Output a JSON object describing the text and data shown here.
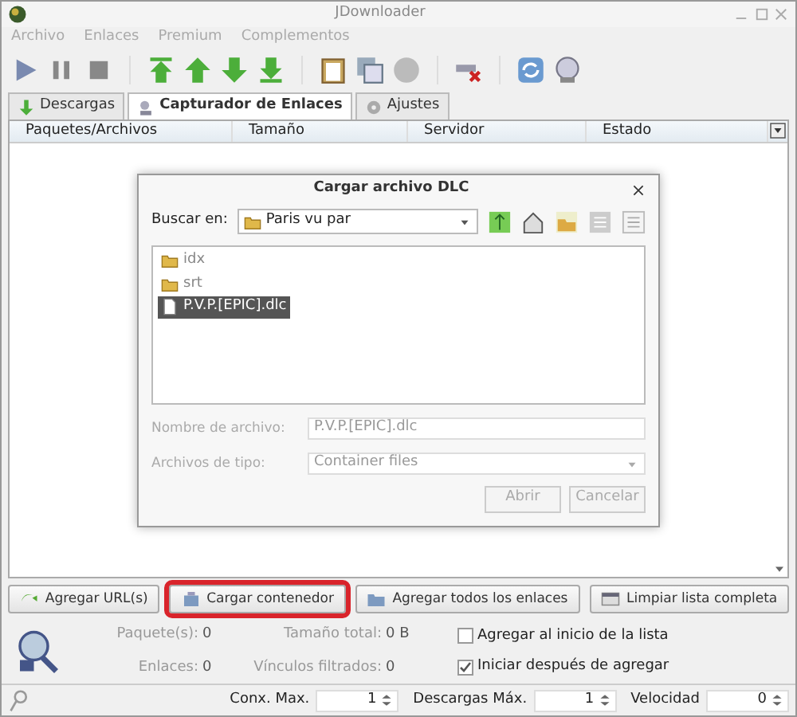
{
  "window": {
    "title": "JDownloader"
  },
  "menu": [
    "Archivo",
    "Enlaces",
    "Premium",
    "Complementos"
  ],
  "tabs": [
    {
      "label": "Descargas",
      "selected": false
    },
    {
      "label": "Capturador de Enlaces",
      "selected": true
    },
    {
      "label": "Ajustes",
      "selected": false
    }
  ],
  "table": {
    "columns": [
      "Paquetes/Archivos",
      "Tamaño",
      "Servidor",
      "Estado"
    ]
  },
  "dialog": {
    "title": "Cargar archivo DLC",
    "look_in_label": "Buscar en:",
    "look_in_value": "Paris vu par",
    "files": [
      {
        "name": "idx",
        "kind": "folder",
        "selected": false
      },
      {
        "name": "srt",
        "kind": "folder",
        "selected": false
      },
      {
        "name": "P.V.P.[EPIC].dlc",
        "kind": "file",
        "selected": true
      }
    ],
    "filename_label": "Nombre de archivo:",
    "filename_value": "P.V.P.[EPIC].dlc",
    "filetype_label": "Archivos de tipo:",
    "filetype_value": "Container files",
    "buttons": [
      "Abrir",
      "Cancelar"
    ]
  },
  "actions": [
    {
      "label": "Agregar URL(s)",
      "highlighted": false
    },
    {
      "label": "Cargar contenedor",
      "highlighted": true
    },
    {
      "label": "Agregar todos los enlaces",
      "highlighted": false
    },
    {
      "label": "Limpiar lista completa",
      "highlighted": false
    }
  ],
  "stats": [
    {
      "label": "Paquete(s):",
      "value": "0"
    },
    {
      "label": "Tamaño total:",
      "value": "0 B"
    },
    {
      "label": "Enlaces:",
      "value": "0"
    },
    {
      "label": "Vínculos filtrados:",
      "value": "0"
    }
  ],
  "options": [
    {
      "label": "Agregar al inicio de la lista",
      "checked": false
    },
    {
      "label": "Iniciar después de agregar",
      "checked": true
    }
  ],
  "status_bar": [
    {
      "label": "Conx. Max.",
      "value": "1"
    },
    {
      "label": "Descargas Máx.",
      "value": "1"
    },
    {
      "label": "Velocidad",
      "value": "0"
    }
  ]
}
